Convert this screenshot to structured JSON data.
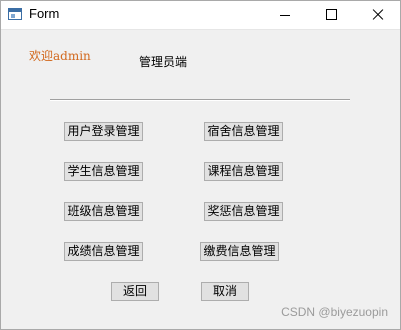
{
  "window": {
    "title": "Form"
  },
  "header": {
    "welcome": "欢迎admin",
    "role": "管理员端"
  },
  "buttons": {
    "user_login": "用户登录管理",
    "dorm_info": "宿舍信息管理",
    "student_info": "学生信息管理",
    "course_info": "课程信息管理",
    "class_info": "班级信息管理",
    "reward_info": "奖惩信息管理",
    "grade_info": "成绩信息管理",
    "payment_info": "缴费信息管理",
    "back": "返回",
    "cancel": "取消"
  },
  "watermark": "CSDN @biyezuopin",
  "colors": {
    "welcome": "#d2691e",
    "window_bg": "#f0f0f0",
    "button_bg": "#e1e1e1"
  },
  "icons": {
    "app": "form-window-icon",
    "minimize": "minimize-icon",
    "maximize": "maximize-icon",
    "close": "close-icon"
  }
}
